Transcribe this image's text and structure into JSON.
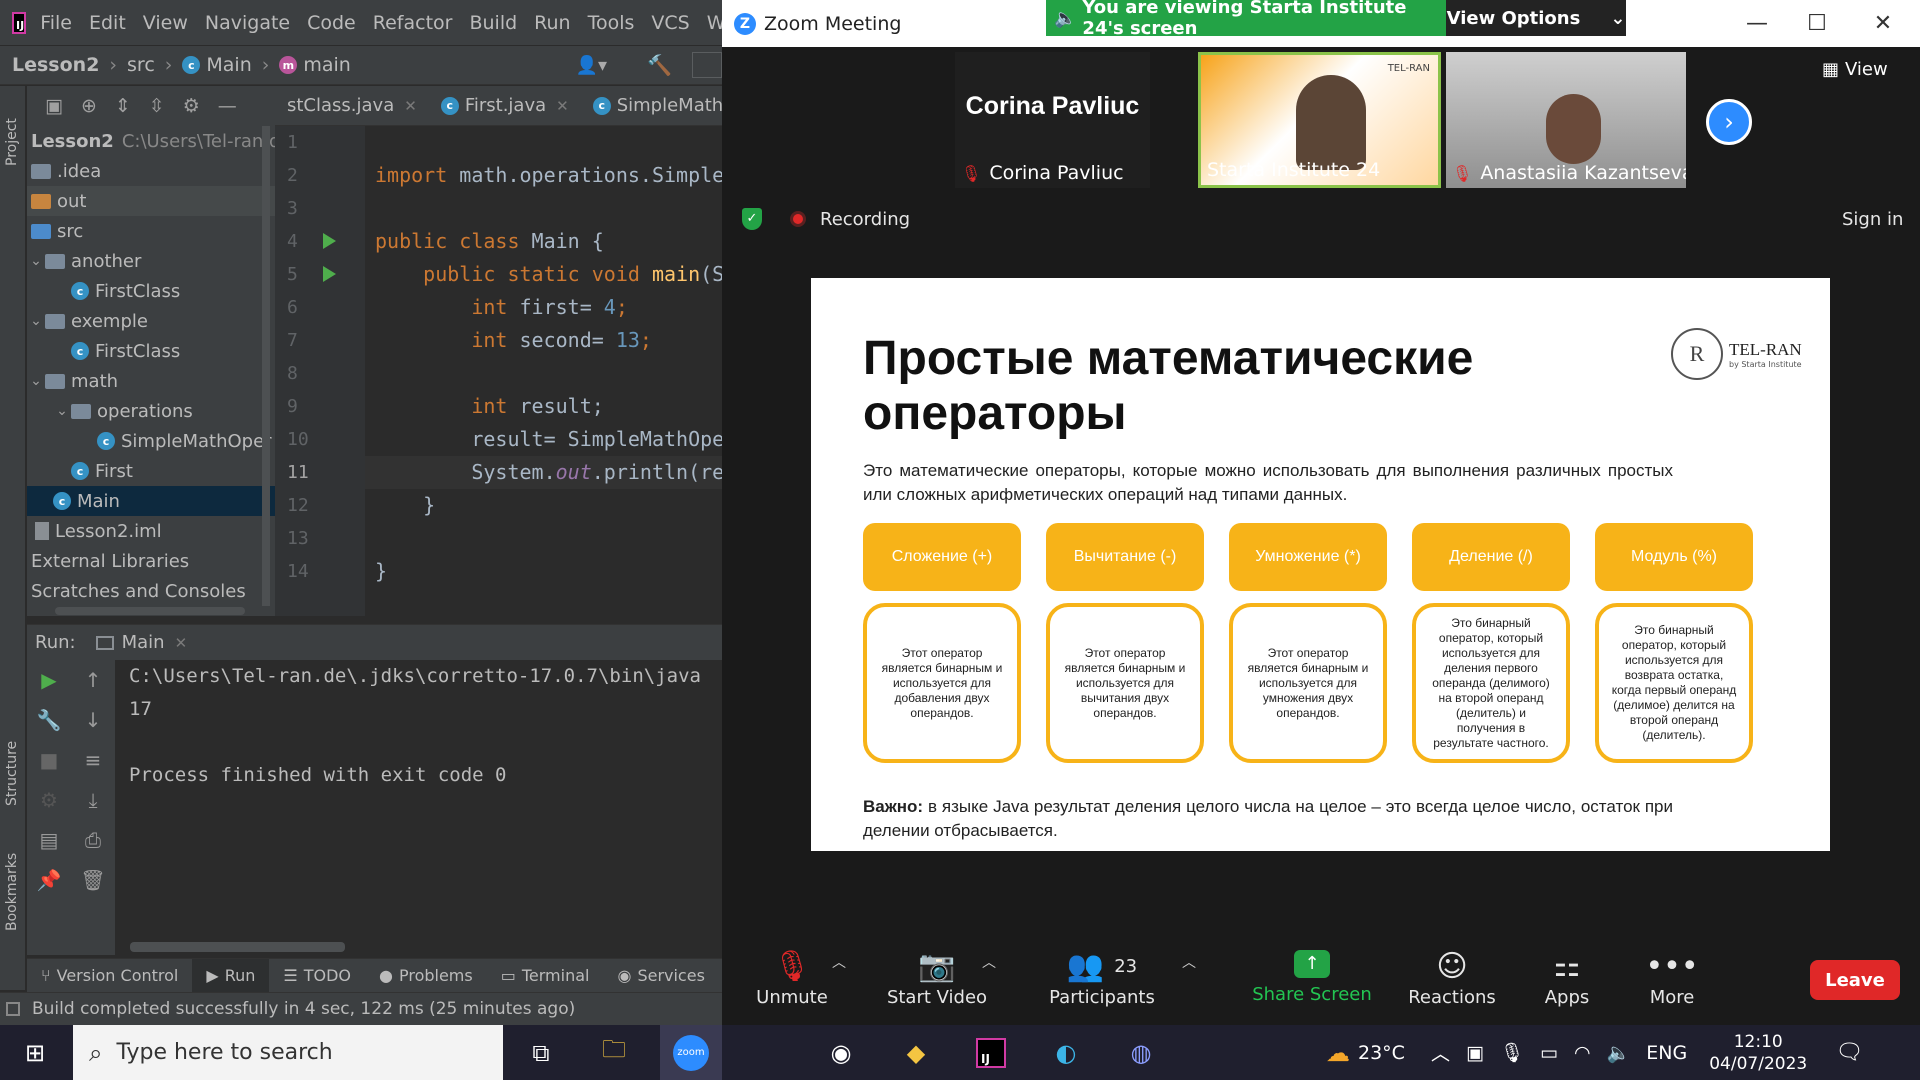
{
  "ide": {
    "menu": [
      "File",
      "Edit",
      "View",
      "Navigate",
      "Code",
      "Refactor",
      "Build",
      "Run",
      "Tools",
      "VCS",
      "Windo"
    ],
    "breadcrumb": [
      "Lesson2",
      "src",
      "Main",
      "main"
    ],
    "side_tabs": {
      "project": "Project",
      "structure": "Structure",
      "bookmarks": "Bookmarks"
    },
    "tree": {
      "root_name": "Lesson2",
      "root_path": "C:\\Users\\Tel-ran.de\\I",
      "items": [
        {
          "label": ".idea",
          "icon": "folder-icon"
        },
        {
          "label": "out",
          "icon": "folder-orange-icon"
        },
        {
          "label": "src",
          "icon": "folder-blue-icon"
        },
        {
          "label": "another",
          "icon": "package-icon"
        },
        {
          "label": "FirstClass",
          "icon": "class-icon"
        },
        {
          "label": "exemple",
          "icon": "package-icon"
        },
        {
          "label": "FirstClass",
          "icon": "class-icon"
        },
        {
          "label": "math",
          "icon": "package-icon"
        },
        {
          "label": "operations",
          "icon": "package-icon"
        },
        {
          "label": "SimpleMathOper",
          "icon": "class-icon"
        },
        {
          "label": "First",
          "icon": "class-icon"
        },
        {
          "label": "Main",
          "icon": "class-icon"
        },
        {
          "label": "Lesson2.iml",
          "icon": "file-icon"
        },
        {
          "label": "External Libraries",
          "icon": "library-icon"
        },
        {
          "label": "Scratches and Consoles",
          "icon": "scratch-icon"
        }
      ]
    },
    "editor_tabs": [
      "stClass.java",
      "First.java",
      "SimpleMathOpera"
    ],
    "line_numbers": [
      "1",
      "2",
      "3",
      "4",
      "5",
      "6",
      "7",
      "8",
      "9",
      "10",
      "11",
      "12",
      "13",
      "14"
    ],
    "code": {
      "l2_kw": "import",
      "l2_rest": " math.operations.Simple",
      "l4_kw": "public class",
      "l4_rest": " Main {",
      "l5_kw": "public static void",
      "l5_fn": "main",
      "l5_rest": "(S",
      "l6_kw": "int",
      "l6_a": " first= ",
      "l6_n": "4",
      "l6_b": ";",
      "l7_kw": "int",
      "l7_a": " second= ",
      "l7_n": "13",
      "l7_b": ";",
      "l9_kw": "int",
      "l9_a": " result;",
      "l10": "result= SimpleMathOpe",
      "l11_a": "System.",
      "l11_it": "out",
      "l11_b": ".println(re",
      "l12": "}",
      "l14": "}"
    },
    "run": {
      "label": "Run:",
      "tab": "Main",
      "console": [
        "C:\\Users\\Tel-ran.de\\.jdks\\corretto-17.0.7\\bin\\java",
        "17",
        "",
        "Process finished with exit code 0"
      ]
    },
    "bottom_tabs": [
      "Version Control",
      "Run",
      "TODO",
      "Problems",
      "Terminal",
      "Services"
    ],
    "status": "Build completed successfully in 4 sec, 122 ms (25 minutes ago)"
  },
  "zoom": {
    "title": "Zoom Meeting",
    "banner": "You are viewing Starta Institute 24's screen",
    "view_options": "View Options",
    "view_btn": "View",
    "participants": [
      {
        "name": "Corina Pavliuc",
        "display": "Corina Pavliuc",
        "muted": true
      },
      {
        "name": "Starta Institute 24",
        "muted": false
      },
      {
        "name": "Anastasiia Kazantseva",
        "muted": true
      }
    ],
    "tile_logo": "TEL-RAN",
    "recording": "Recording",
    "sign_in": "Sign in",
    "slide": {
      "title": "Простые математические операторы",
      "logo": "TEL-RAN",
      "logo_sub": "by Starta Institute",
      "intro": "Это математические операторы, которые можно использовать для выполнения различных простых или сложных арифметических операций над типами данных.",
      "operators": [
        {
          "name": "Сложение (+)",
          "desc": "Этот оператор является бинарным и используется для добавления двух операндов."
        },
        {
          "name": "Вычитание (-)",
          "desc": "Этот оператор является бинарным и используется для вычитания двух операндов."
        },
        {
          "name": "Умножение (*)",
          "desc": "Этот оператор является бинарным и используется для умножения двух операндов."
        },
        {
          "name": "Деление (/)",
          "desc": "Это бинарный оператор, который используется для деления первого операнда (делимого) на второй операнд (делитель) и получения в результате частного."
        },
        {
          "name": "Модуль (%)",
          "desc": "Это бинарный оператор, который используется для возврата остатка, когда первый операнд (делимое) делится на второй операнд (делитель)."
        }
      ],
      "note_bold": "Важно:",
      "note": " в языке Java результат деления целого числа на целое – это всегда целое число, остаток при делении отбрасывается."
    },
    "controls": {
      "unmute": "Unmute",
      "video": "Start Video",
      "participants": "Participants",
      "participant_count": "23",
      "share": "Share Screen",
      "reactions": "Reactions",
      "apps": "Apps",
      "more": "More",
      "leave": "Leave"
    },
    "colors": {
      "banner": "#23a346",
      "slide_accent": "#f7b318",
      "leave": "#e02828"
    }
  },
  "taskbar": {
    "search_placeholder": "Type here to search",
    "temperature": "23°C",
    "language": "ENG",
    "time": "12:10",
    "date": "04/07/2023"
  }
}
